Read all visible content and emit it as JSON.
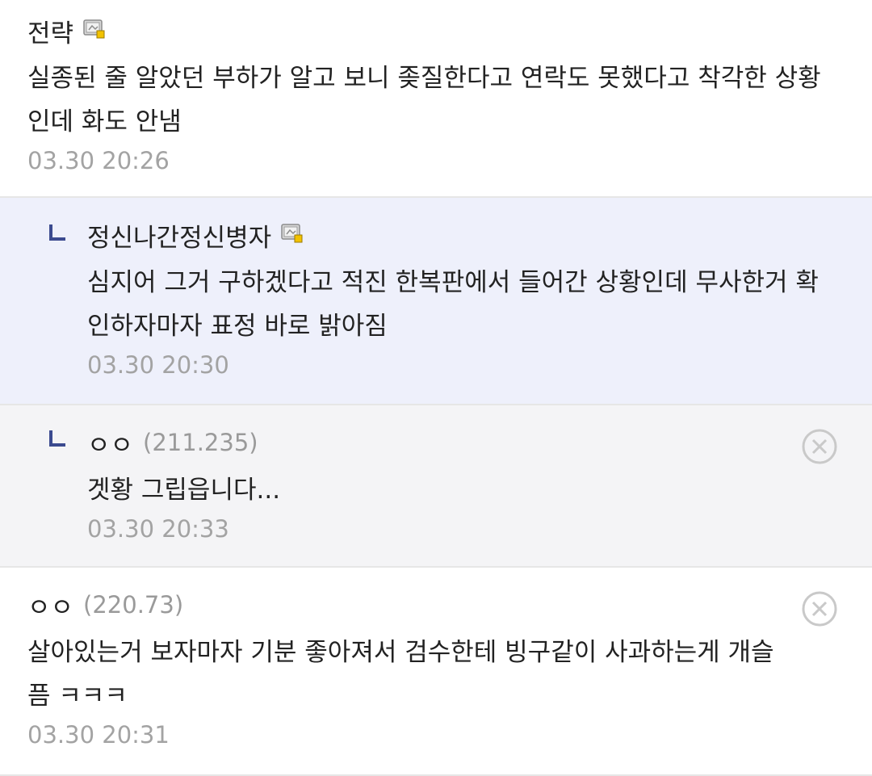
{
  "comments": [
    {
      "nick": "전략",
      "ip": "",
      "text": "실종된 줄 알았던 부하가 알고 보니 좆질한다고 연락도 못했다고 착각한 상황인데 화도 안냄",
      "date": "03.30 20:26",
      "gallog_icon": "gallog-icon"
    },
    {
      "nick": "정신나간정신병자",
      "ip": "",
      "text": "심지어 그거 구하겠다고 적진 한복판에서 들어간 상황인데 무사한거 확인하자마자 표정 바로 밝아짐",
      "date": "03.30 20:30",
      "gallog_icon": "gallog-icon",
      "reply_icon": "reply-arrow-icon"
    },
    {
      "nick": "ㅇㅇ",
      "ip": "(211.235)",
      "text": "겟황 그립읍니다...",
      "date": "03.30 20:33",
      "reply_icon": "reply-arrow-icon",
      "delete_icon": "delete-circle-x-icon"
    },
    {
      "nick": "ㅇㅇ",
      "ip": "(220.73)",
      "text": "살아있는거 보자마자 기분 좋아져서 검수한테 빙구같이 사과하는게 개슬픔 ㅋㅋㅋ",
      "date": "03.30 20:31",
      "delete_icon": "delete-circle-x-icon"
    }
  ],
  "colors": {
    "reply_bg": "#eef0fb",
    "anon_reply_bg": "#f4f4f6",
    "reply_arrow": "#3b4a8f",
    "meta_gray": "#a3a3a3",
    "divider": "#e6e6e6"
  }
}
